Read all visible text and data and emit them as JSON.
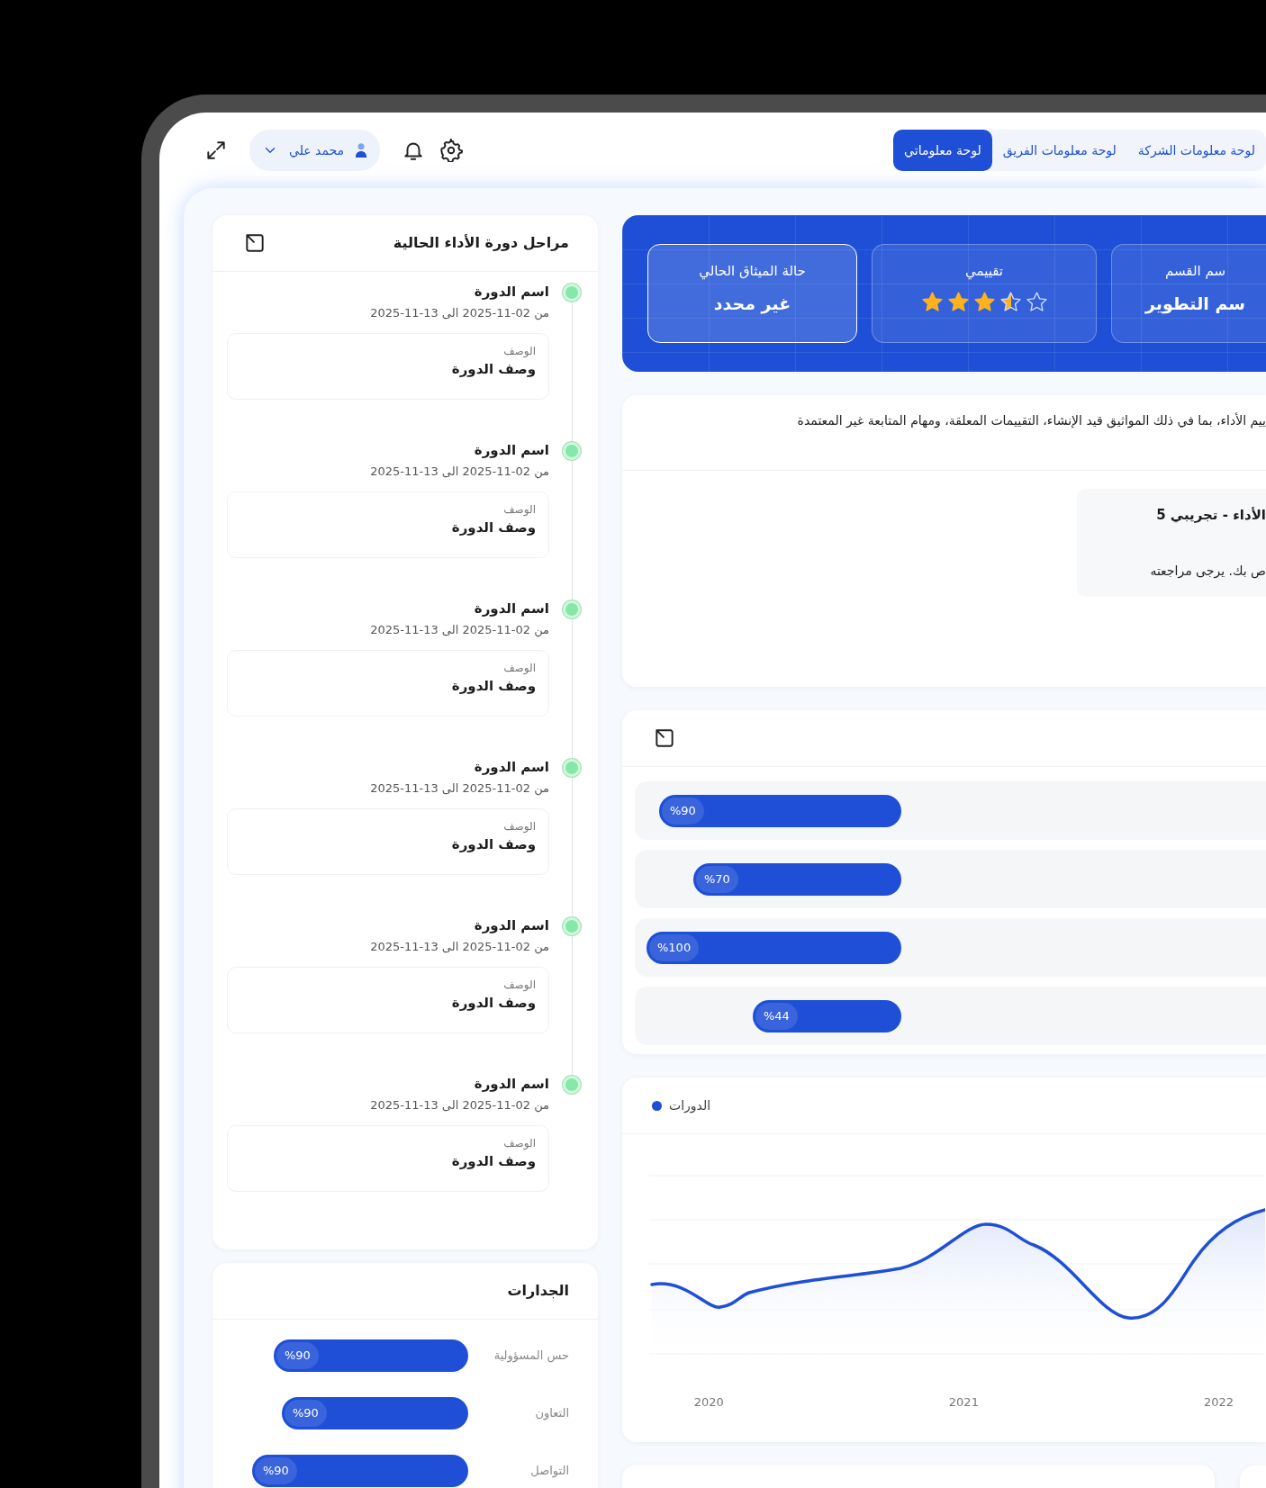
{
  "nav": {
    "tabs": [
      {
        "label": "لوحة معلومات الشركة",
        "selected": false
      },
      {
        "label": "لوحة معلومات الفريق",
        "selected": false
      },
      {
        "label": "لوحة معلوماتي",
        "selected": true
      }
    ],
    "user": {
      "name": "محمد علي"
    }
  },
  "timeline": {
    "title": "مراحل دورة الأداء الحالية",
    "items": [
      {
        "name": "اسم الدورة",
        "dates": "من 02-11-2025 الى 13-11-2025",
        "description_label": "الوصف",
        "description": "وصف الدورة"
      },
      {
        "name": "اسم الدورة",
        "dates": "من 02-11-2025 الى 13-11-2025",
        "description_label": "الوصف",
        "description": "وصف الدورة"
      },
      {
        "name": "اسم الدورة",
        "dates": "من 02-11-2025 الى 13-11-2025",
        "description_label": "الوصف",
        "description": "وصف الدورة"
      },
      {
        "name": "اسم الدورة",
        "dates": "من 02-11-2025 الى 13-11-2025",
        "description_label": "الوصف",
        "description": "وصف الدورة"
      },
      {
        "name": "اسم الدورة",
        "dates": "من 02-11-2025 الى 13-11-2025",
        "description_label": "الوصف",
        "description": "وصف الدورة"
      },
      {
        "name": "اسم الدورة",
        "dates": "من 02-11-2025 الى 13-11-2025",
        "description_label": "الوصف",
        "description": "وصف الدورة"
      }
    ]
  },
  "competencies": {
    "title": "الجدارات",
    "items": [
      {
        "label": "حس المسؤولية",
        "reading": "%90"
      },
      {
        "label": "التعاون",
        "reading": "%90"
      },
      {
        "label": "التواصل",
        "reading": "%90"
      }
    ]
  },
  "summary": {
    "cards": [
      {
        "kind": "text",
        "label": "سم القسم",
        "value": "سم التطوير",
        "selected": false
      },
      {
        "kind": "stars",
        "label": "تقييمي",
        "stars": 3.5,
        "selected": false
      },
      {
        "kind": "text",
        "label": "حالة الميثاق الحالي",
        "value": "غير محدد",
        "selected": true
      }
    ]
  },
  "notice": {
    "text": "ييم الأداء، بما في ذلك المواثيق قيد الإنشاء، التقييمات المعلقة، ومهام المتابعة غير المعتمدة",
    "item": {
      "title": "الأداء - تجريبي 5",
      "text": "ص بك. يرجى مراجعته"
    }
  },
  "progress": {
    "rows": [
      {
        "reading": "%90"
      },
      {
        "reading": "%70"
      },
      {
        "reading": "%100"
      },
      {
        "reading": "%44"
      }
    ]
  },
  "trend": {
    "legend": "الدورات",
    "x_labels": [
      "2022",
      "2021",
      "2020"
    ]
  }
}
